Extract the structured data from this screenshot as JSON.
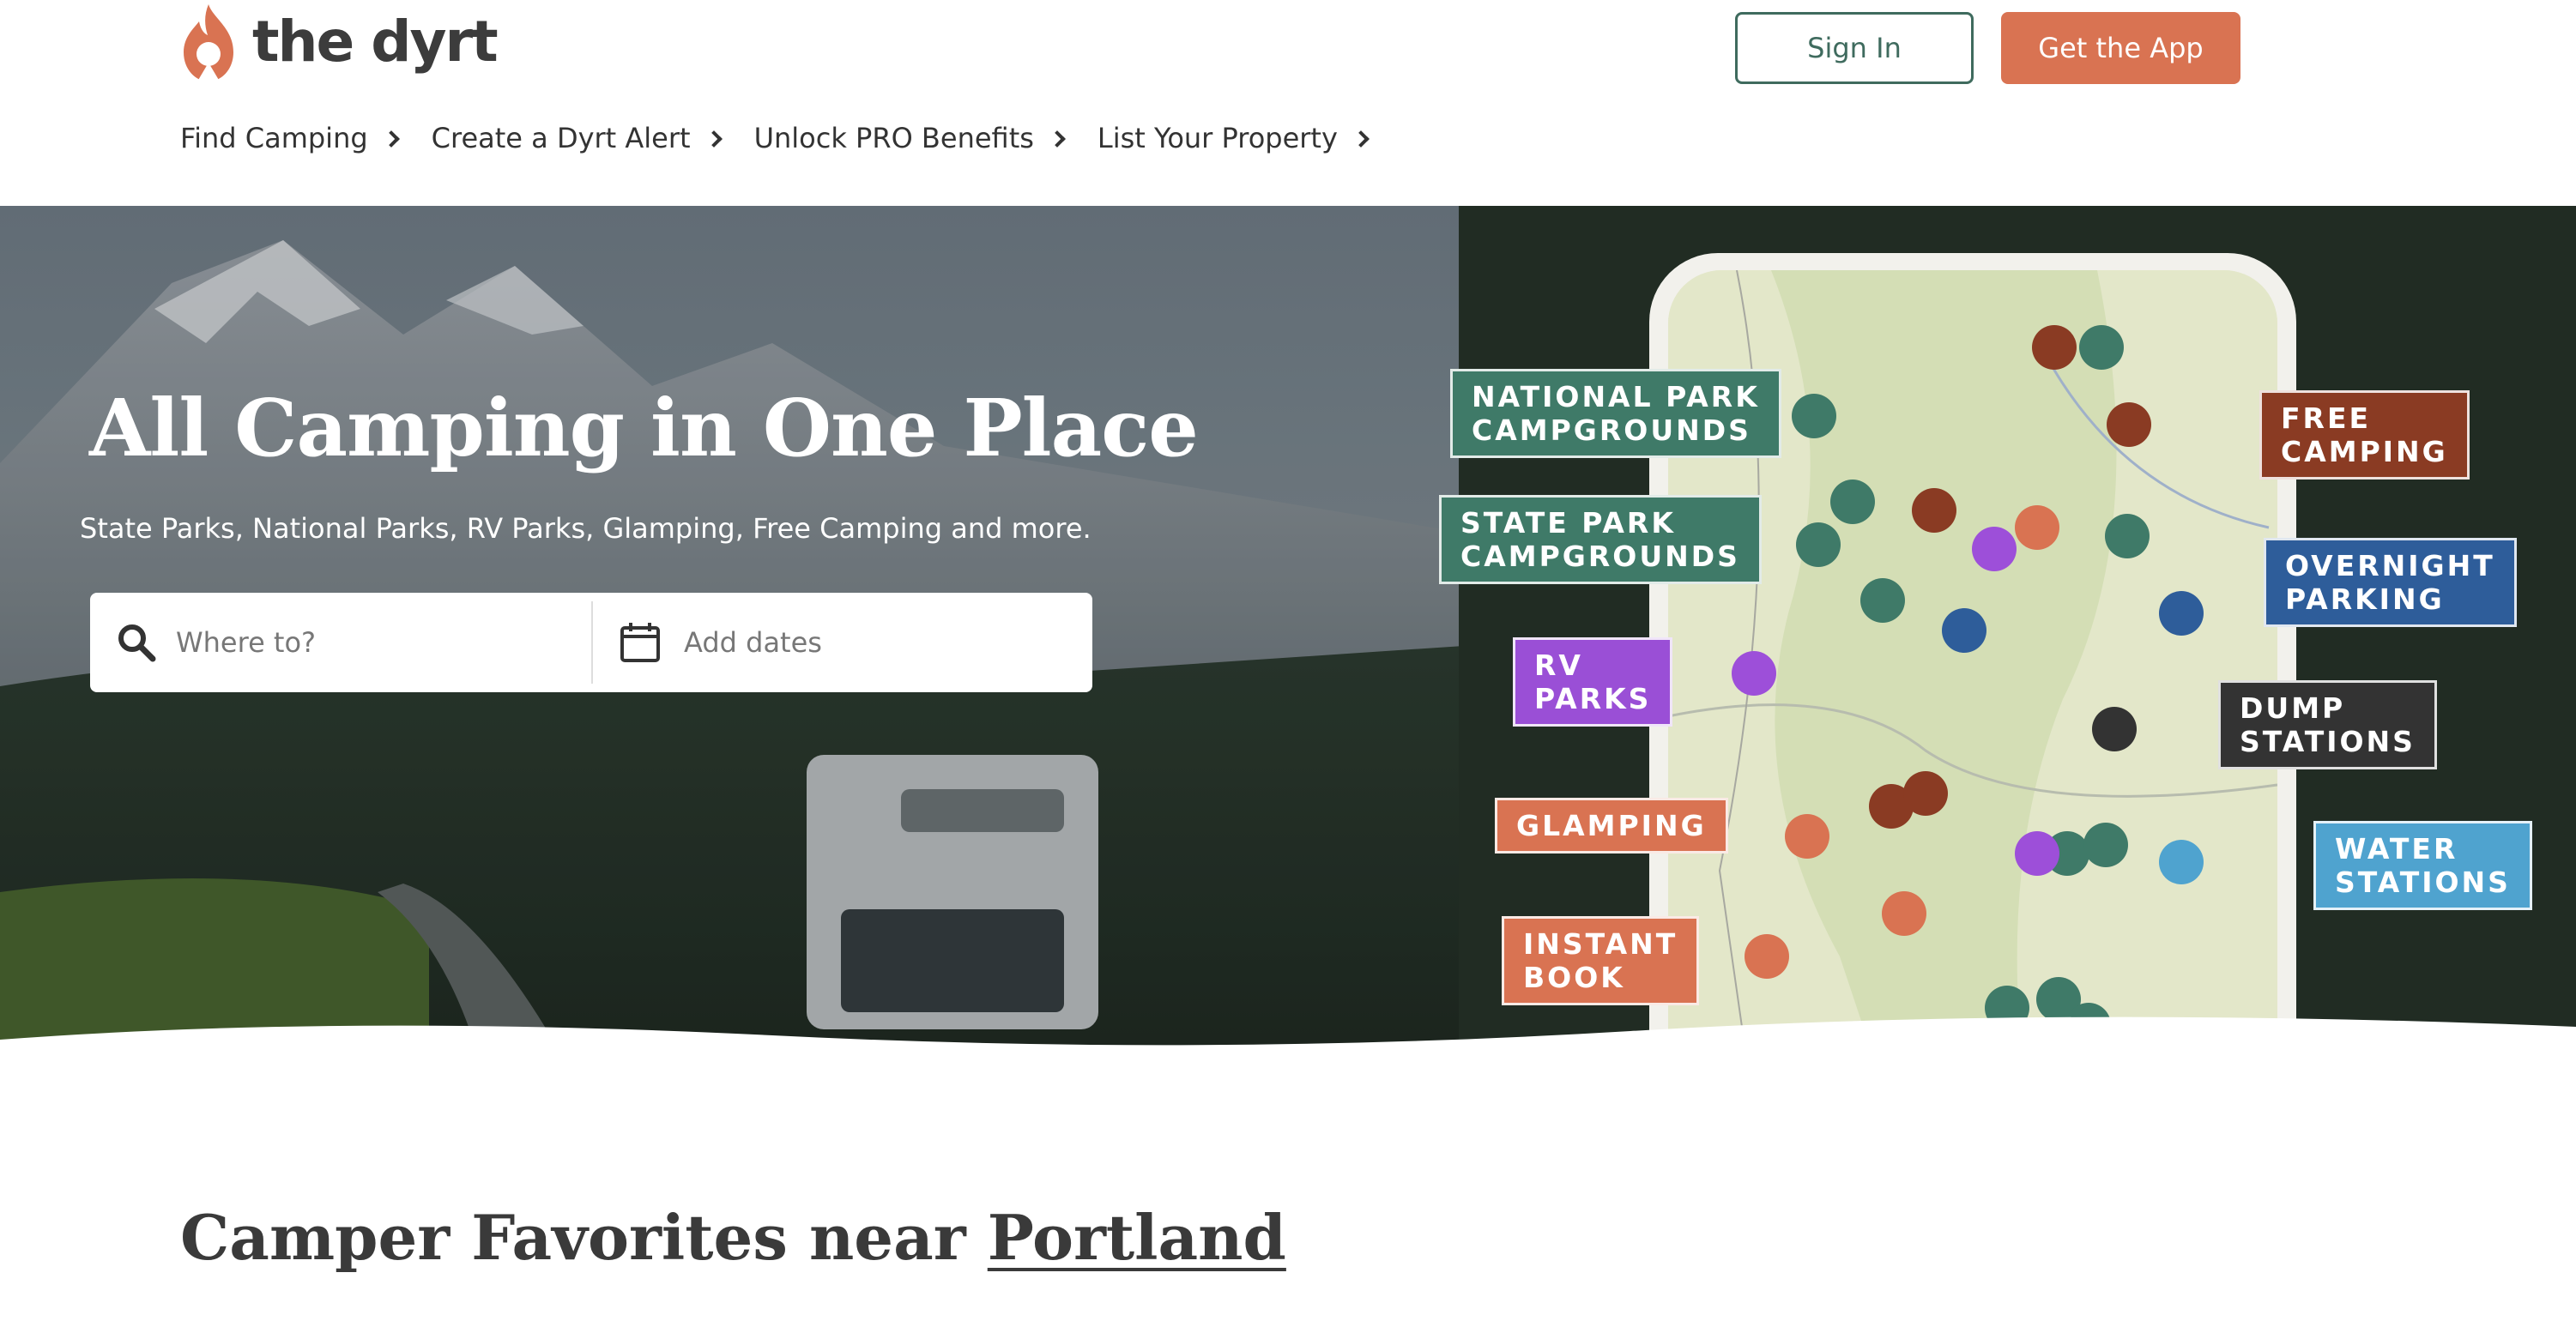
{
  "brand": {
    "name": "the dyrt",
    "accent": "#d97352",
    "green": "#3f6b5e"
  },
  "header": {
    "sign_in": "Sign In",
    "get_app": "Get the App",
    "nav": [
      {
        "label": "Find Camping"
      },
      {
        "label": "Create a Dyrt Alert"
      },
      {
        "label": "Unlock PRO Benefits"
      },
      {
        "label": "List Your Property"
      }
    ]
  },
  "hero": {
    "title": "All Camping in One Place",
    "subtitle": "State Parks, National Parks, RV Parks, Glamping, Free Camping and more.",
    "search_placeholder": "Where to?",
    "dates_placeholder": "Add dates"
  },
  "map_tags": {
    "national": [
      "NATIONAL PARK",
      "CAMPGROUNDS"
    ],
    "state": [
      "STATE PARK",
      "CAMPGROUNDS"
    ],
    "rv": [
      "RV",
      "PARKS"
    ],
    "glamping": [
      "GLAMPING"
    ],
    "instant": [
      "INSTANT",
      "BOOK"
    ],
    "free": [
      "FREE",
      "CAMPING"
    ],
    "overnight": [
      "OVERNIGHT",
      "PARKING"
    ],
    "dump": [
      "DUMP",
      "STATIONS"
    ],
    "water": [
      "WATER",
      "STATIONS"
    ]
  },
  "section": {
    "prefix": "Camper Favorites near ",
    "place": "Portland"
  }
}
